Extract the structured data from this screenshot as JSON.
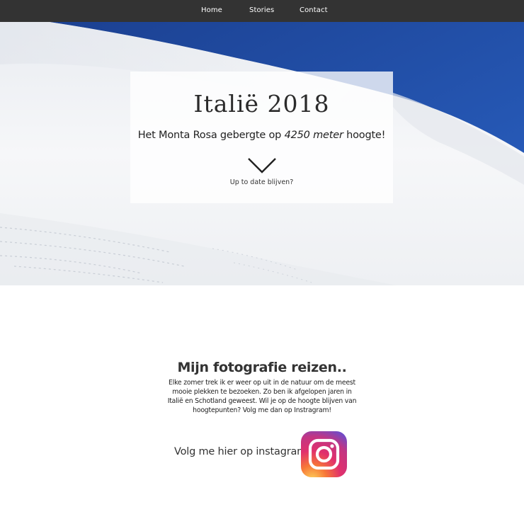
{
  "nav": {
    "items": [
      {
        "label": "Home"
      },
      {
        "label": "Stories"
      },
      {
        "label": "Contact"
      }
    ]
  },
  "hero": {
    "title": "Italië 2018",
    "subtitle_prefix": "Het Monta Rosa gebergte op ",
    "subtitle_emphasis": "4250 meter",
    "subtitle_suffix": " hoogte!",
    "cta_label": "Up to date blijven?",
    "cta_icon": "chevron-down-icon"
  },
  "content": {
    "heading": "Mijn fotografie reizen..",
    "body": "Elke zomer trek ik er weer op uit in de natuur om de meest mooie plekken te bezoeken. Zo ben ik afgelopen jaren in Italië en Schotland geweest. Wil je op de hoogte blijven van hoogtepunten? Volg me dan op Instragram!",
    "instagram_label": "Volg me hier op instagram!",
    "instagram_icon": "instagram-icon"
  },
  "colors": {
    "nav_bg": "#333333",
    "sky": "#1f4ea6",
    "snow": "#f3f4f6"
  }
}
